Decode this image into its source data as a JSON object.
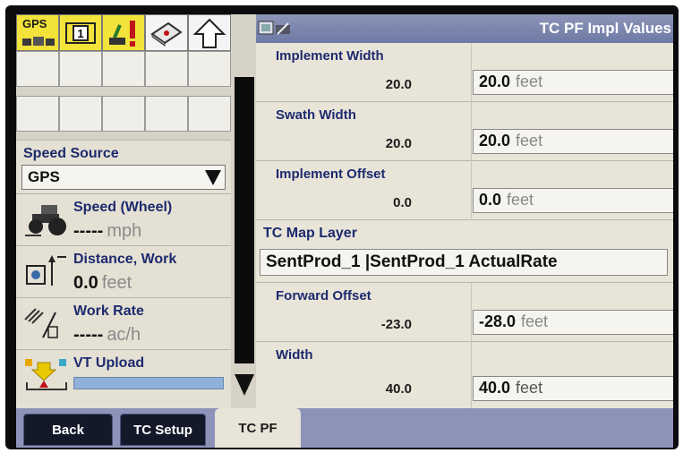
{
  "status_icons": [
    {
      "name": "gps-receiver-icon",
      "label": "GPS",
      "color": "#f2e23a"
    },
    {
      "name": "implement-number-icon",
      "label": "1",
      "color": "#f2e23a"
    },
    {
      "name": "warning-alert-icon",
      "label": "",
      "color": "#f2e23a"
    },
    {
      "name": "field-book-icon",
      "label": "",
      "color": "#f4f4f4"
    },
    {
      "name": "home-arrow-icon",
      "label": "",
      "color": "#f4f4f4"
    }
  ],
  "speed_source": {
    "label": "Speed Source",
    "value": "GPS"
  },
  "speed": {
    "title": "Speed (Wheel)",
    "value": "-----",
    "unit": "mph"
  },
  "distance": {
    "title": "Distance, Work",
    "value": "0.0",
    "unit": "feet"
  },
  "work_rate": {
    "title": "Work Rate",
    "value": "-----",
    "unit": "ac/h"
  },
  "vt_upload": {
    "title": "VT Upload",
    "progress": 1.0
  },
  "panel": {
    "title": "TC PF Impl Values"
  },
  "rows": {
    "implement_width": {
      "label": "Implement Width",
      "current": "20.0",
      "value": "20.0",
      "unit": "feet"
    },
    "swath_width": {
      "label": "Swath Width",
      "current": "20.0",
      "value": "20.0",
      "unit": "feet"
    },
    "implement_offset": {
      "label": "Implement Offset",
      "current": "0.0",
      "value": "0.0",
      "unit": "feet"
    },
    "forward_offset": {
      "label": "Forward Offset",
      "current": "-23.0",
      "value": "-28.0",
      "unit": "feet"
    },
    "width": {
      "label": "Width",
      "current": "40.0",
      "value": "40.0",
      "unit": "feet"
    }
  },
  "tc_map_layer": {
    "label": "TC Map Layer",
    "value": "SentProd_1 |SentProd_1 ActualRate"
  },
  "tabs": {
    "back": "Back",
    "tc_setup": "TC Setup",
    "tc_pf": "TC PF"
  },
  "colors": {
    "accent_blue": "#1d2a6e",
    "title_bar": "#7a85ad",
    "tab_dark": "#14192a",
    "panel_bg": "#e8e4d8"
  }
}
